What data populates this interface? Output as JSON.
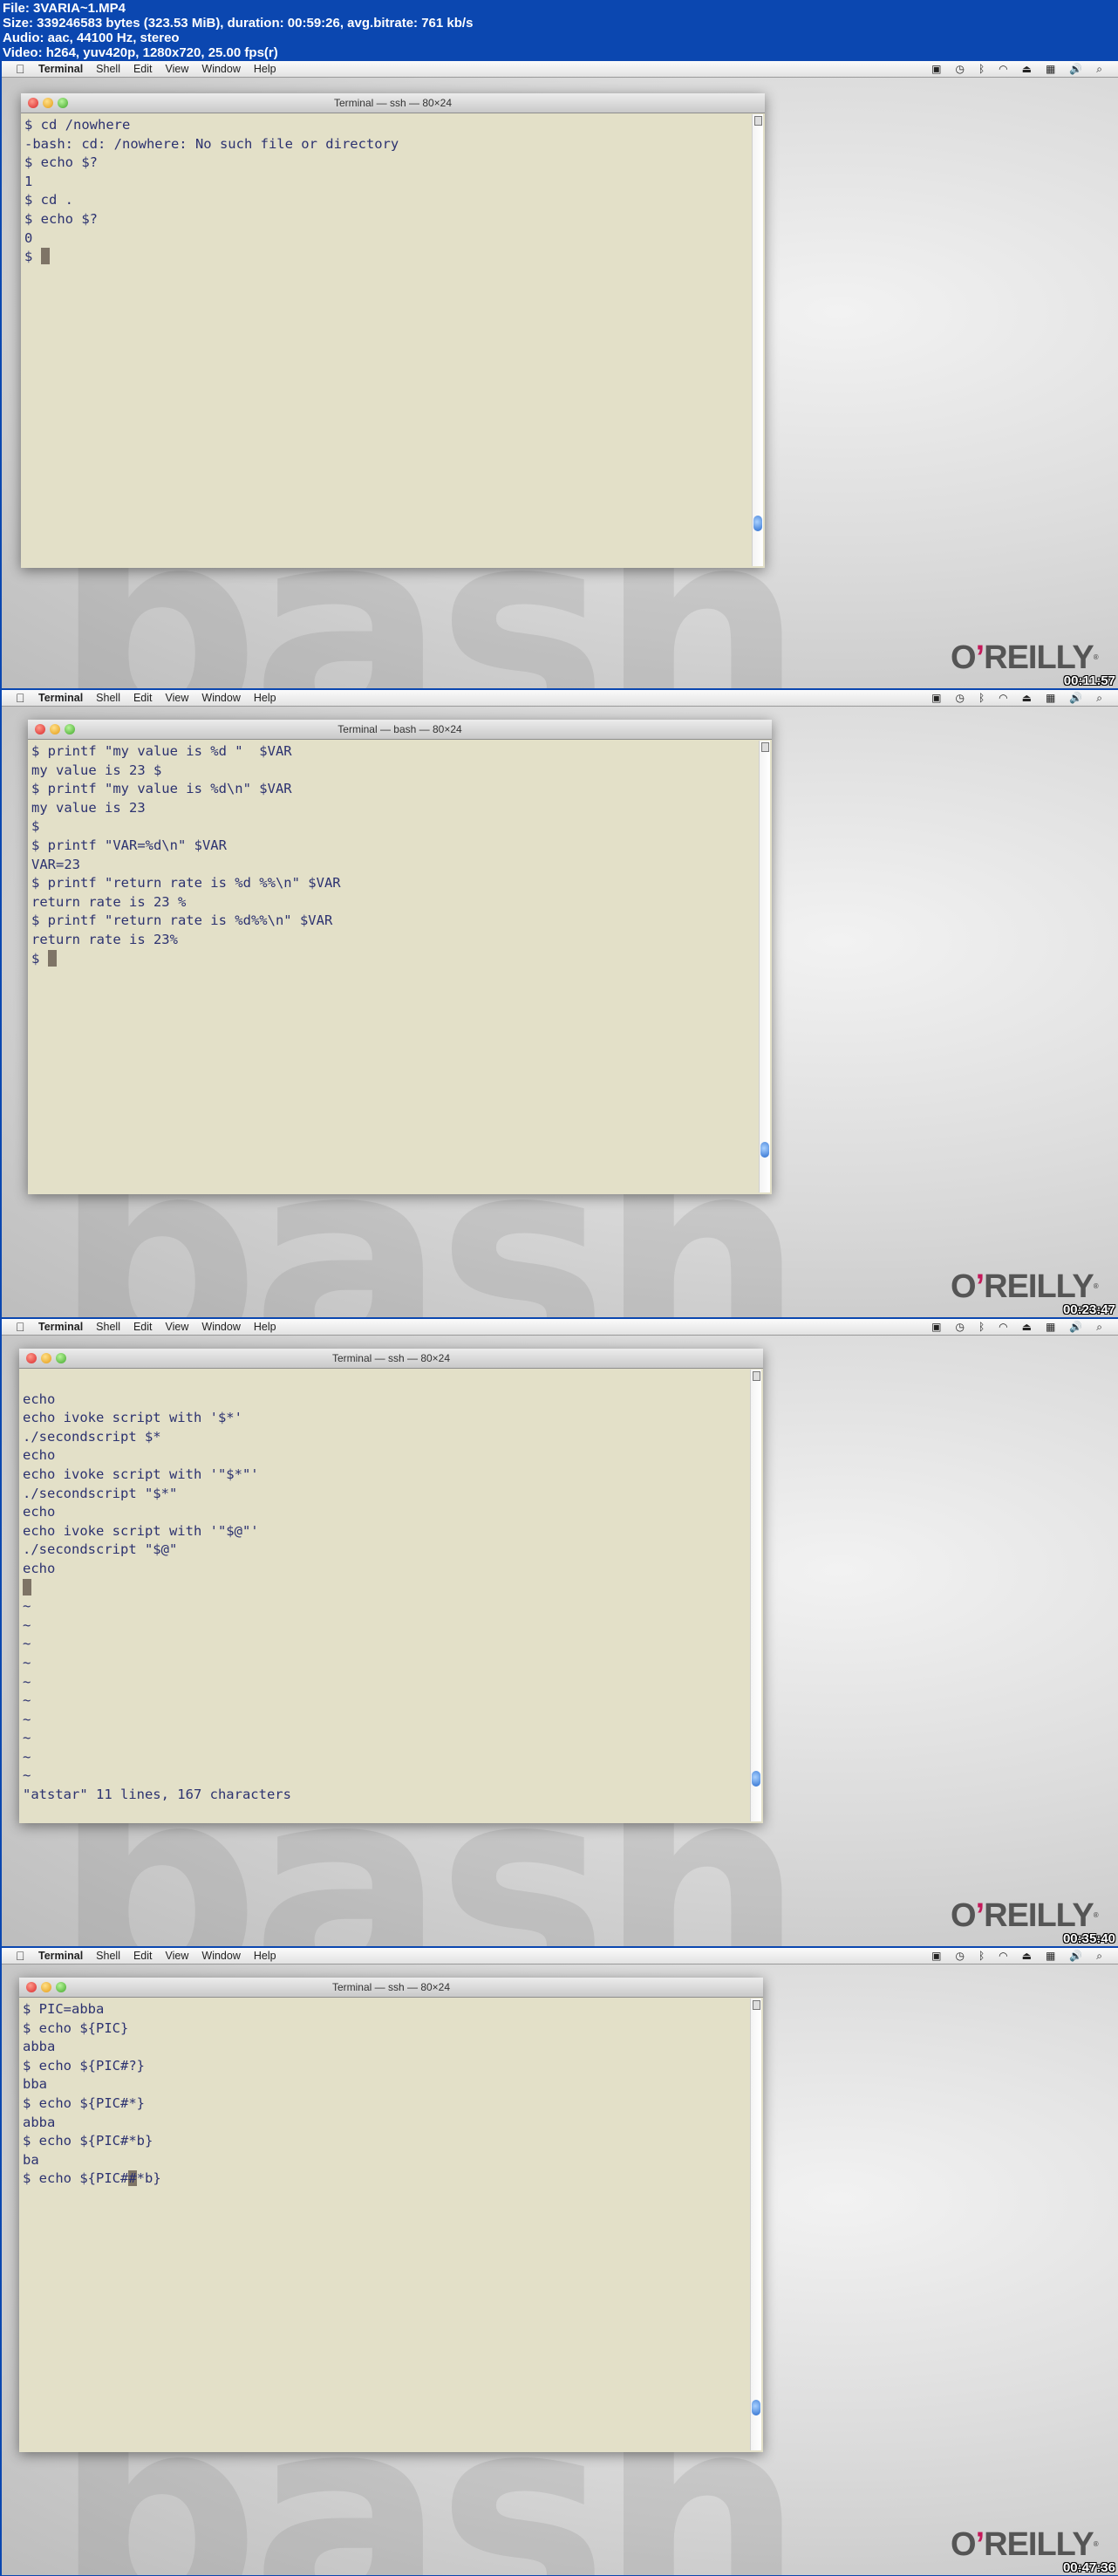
{
  "file_info": [
    "File: 3VARIA~1.MP4",
    "Size: 339246583 bytes (323.53 MiB), duration: 00:59:26, avg.bitrate: 761 kb/s",
    "Audio: aac, 44100 Hz, stereo",
    "Video: h264, yuv420p, 1280x720, 25.00 fps(r)"
  ],
  "menubar": {
    "apple_icon": "apple-icon",
    "items": [
      "Terminal",
      "Shell",
      "Edit",
      "View",
      "Window",
      "Help"
    ],
    "tray_icons": [
      "screen-record-icon",
      "time-machine-icon",
      "bluetooth-icon",
      "wifi-icon",
      "eject-icon",
      "spaces-icon",
      "volume-icon",
      "spotlight-search-icon"
    ]
  },
  "watermark": "bash",
  "logo": "O'REILLY",
  "colors": {
    "terminal_bg": "#e3e0c8",
    "terminal_text": "#2c3270",
    "info_bar": "#0b47b0",
    "logo_apostrophe": "#c4195a"
  },
  "frames": [
    {
      "window_title": "Terminal — ssh — 80×24",
      "timestamp": "00:11:57",
      "lines": [
        "$ cd /nowhere",
        "-bash: cd: /nowhere: No such file or directory",
        "$ echo $?",
        "1",
        "$ cd .",
        "$ echo $?",
        "0",
        "$ "
      ],
      "cursor_line": 7
    },
    {
      "window_title": "Terminal — bash — 80×24",
      "timestamp": "00:23:47",
      "lines": [
        "$ printf \"my value is %d \"  $VAR",
        "my value is 23 $",
        "$ printf \"my value is %d\\n\" $VAR",
        "my value is 23",
        "$",
        "$ printf \"VAR=%d\\n\" $VAR",
        "VAR=23",
        "$ printf \"return rate is %d %%\\n\" $VAR",
        "return rate is 23 %",
        "$ printf \"return rate is %d%%\\n\" $VAR",
        "return rate is 23%",
        "$ "
      ],
      "cursor_line": 11
    },
    {
      "window_title": "Terminal — ssh — 80×24",
      "timestamp": "00:35:40",
      "lines": [
        "",
        "echo",
        "echo ivoke script with '$*'",
        "./secondscript $*",
        "echo",
        "echo ivoke script with '\"$*\"'",
        "./secondscript \"$*\"",
        "echo",
        "echo ivoke script with '\"$@\"'",
        "./secondscript \"$@\"",
        "echo",
        "",
        "~",
        "~",
        "~",
        "~",
        "~",
        "~",
        "~",
        "~",
        "~",
        "~",
        "\"atstar\" 11 lines, 167 characters"
      ],
      "cursor_line": 11
    },
    {
      "window_title": "Terminal — ssh — 80×24",
      "timestamp": "00:47:36",
      "lines": [
        "$ PIC=abba",
        "$ echo ${PIC}",
        "abba",
        "$ echo ${PIC#?}",
        "bba",
        "$ echo ${PIC#*}",
        "abba",
        "$ echo ${PIC#*b}",
        "ba",
        "$ echo ${PIC##*b}"
      ],
      "cursor_line": 9,
      "cursor_char": 13
    }
  ]
}
